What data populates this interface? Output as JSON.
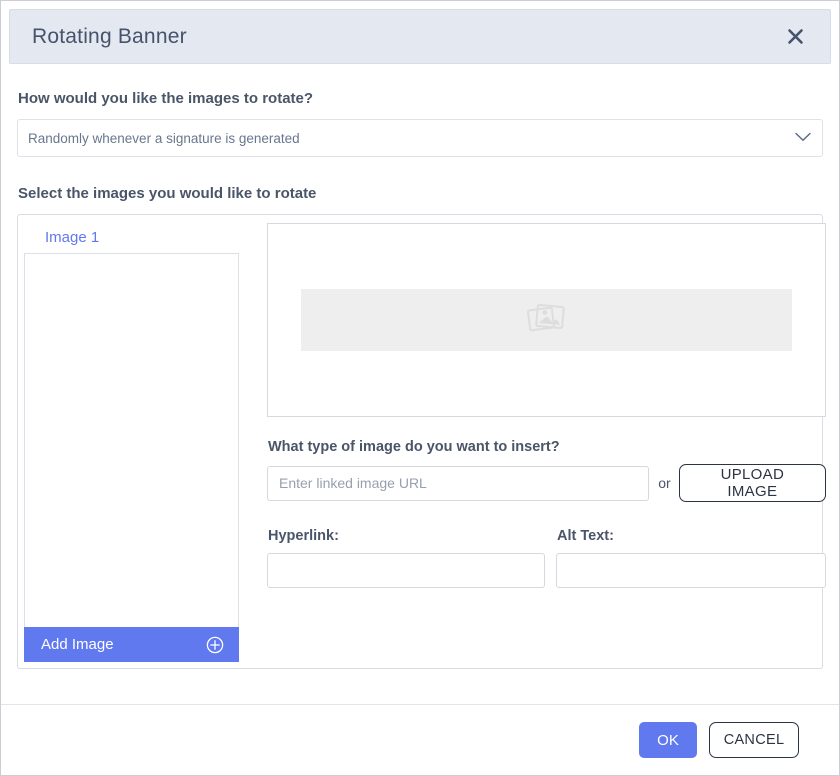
{
  "dialog": {
    "title": "Rotating Banner",
    "close_icon": "close-icon"
  },
  "rotation": {
    "question_label": "How would you like the images to rotate?",
    "selected_option": "Randomly whenever a signature is generated",
    "chevron_icon": "chevron-down-icon"
  },
  "images": {
    "section_label": "Select the images you would like to rotate",
    "list": [
      {
        "label": "Image 1"
      }
    ],
    "add_button_label": "Add Image",
    "add_button_icon": "plus-circle-icon",
    "preview_placeholder_icon": "photos-stack-icon"
  },
  "image_detail": {
    "type_label": "What type of image do you want to insert?",
    "url_placeholder": "Enter linked image URL",
    "url_value": "",
    "or_text": "or",
    "upload_label": "UPLOAD IMAGE",
    "hyperlink_label": "Hyperlink:",
    "hyperlink_value": "",
    "alt_text_label": "Alt Text:",
    "alt_text_value": ""
  },
  "footer": {
    "ok_label": "OK",
    "cancel_label": "CANCEL"
  },
  "colors": {
    "accent_blue": "#6179ef",
    "header_bg": "#e4e8f1",
    "label_text": "#4a5568",
    "dark_outline": "#2b3445"
  }
}
